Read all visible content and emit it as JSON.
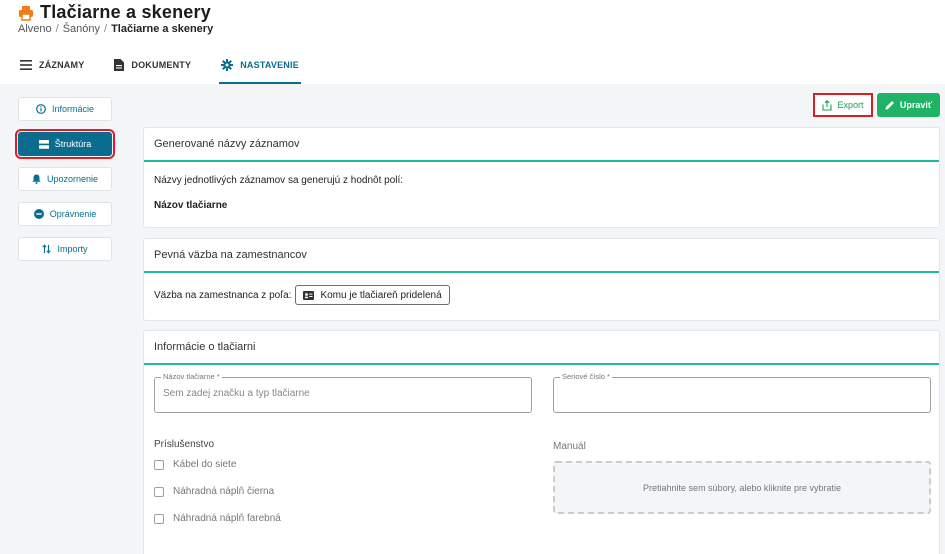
{
  "header": {
    "title": "Tlačiarne a skenery",
    "breadcrumb": [
      "Alveno",
      "Šanóny",
      "Tlačiarne a skenery"
    ],
    "breadcrumb_sep": "/"
  },
  "tabs": [
    {
      "label": "ZÁZNAMY",
      "icon": "list-icon"
    },
    {
      "label": "DOKUMENTY",
      "icon": "document-icon"
    },
    {
      "label": "NASTAVENIE",
      "icon": "gear-icon",
      "active": true
    }
  ],
  "sidebar": {
    "items": [
      {
        "label": "Informácie",
        "icon": "info-icon"
      },
      {
        "label": "Štruktúra",
        "icon": "structure-icon",
        "active": true
      },
      {
        "label": "Upozornenie",
        "icon": "bell-icon"
      },
      {
        "label": "Oprávnenie",
        "icon": "minus-circle-icon"
      },
      {
        "label": "Importy",
        "icon": "import-icon"
      }
    ]
  },
  "toolbar": {
    "export_label": "Export",
    "edit_label": "Upraviť"
  },
  "sections": {
    "generated_names": {
      "title": "Generované názvy záznamov",
      "description": "Názvy jednotlivých záznamov sa generujú z hodnôt polí:",
      "field": "Názov tlačiarne"
    },
    "binding": {
      "title": "Pevná väzba na zamestnancov",
      "label": "Väzba na zamestnanca z poľa:",
      "chip": "Komu je tlačiareň pridelená"
    },
    "printer_info": {
      "title": "Informácie o tlačiarni",
      "name_field": {
        "label": "Názov tlačiarne *",
        "placeholder": "Sem zadej značku a typ tlačiarne"
      },
      "serial_field": {
        "label": "Seriové číslo *",
        "placeholder": ""
      },
      "accessories_title": "Príslušenstvo",
      "accessories": [
        "Kábel do siete",
        "Náhradná náplň čierna",
        "Náhradná náplň farebná"
      ],
      "manual_title": "Manuál",
      "dropzone_text": "Pretiahnite sem súbory, alebo kliknite pre vybratie"
    }
  },
  "colors": {
    "primary": "#0a6c8f",
    "accent": "#20b9a1",
    "success": "#21b365",
    "highlight": "#d61f26",
    "title_icon": "#f07d1a"
  }
}
